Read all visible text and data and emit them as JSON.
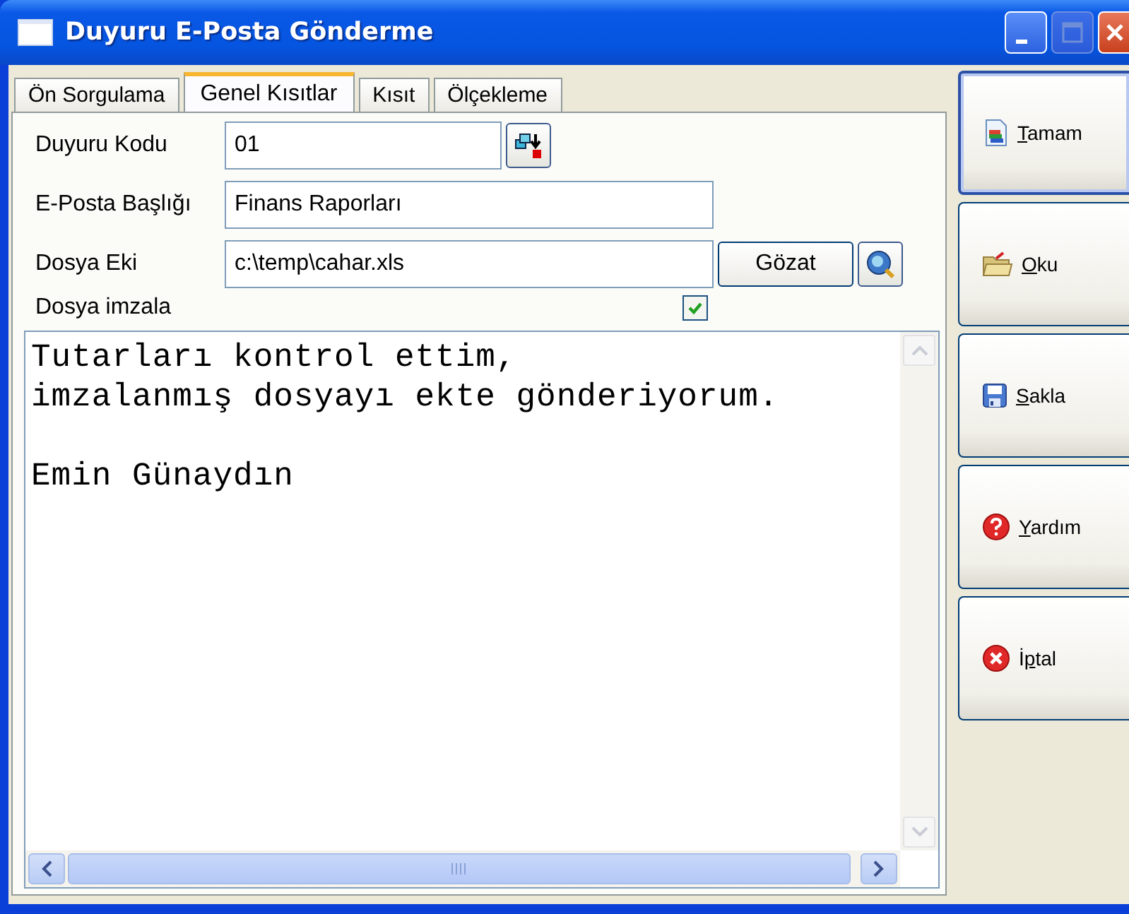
{
  "window": {
    "title": "Duyuru E-Posta Gönderme"
  },
  "tabs": [
    {
      "label": "Ön Sorgulama",
      "selected": false
    },
    {
      "label": "Genel Kısıtlar",
      "selected": true
    },
    {
      "label": "Kısıt",
      "selected": false
    },
    {
      "label": "Ölçekleme",
      "selected": false
    }
  ],
  "fields": [
    {
      "kind": "code",
      "label": "Duyuru Kodu",
      "value": "01"
    },
    {
      "kind": "text",
      "label": "E-Posta Başlığı",
      "value": "Finans Raporları"
    },
    {
      "kind": "file",
      "label": "Dosya Eki",
      "value": "c:\\temp\\cahar.xls",
      "button": "Gözat"
    },
    {
      "kind": "check",
      "label": "Dosya imzala",
      "checked": true
    }
  ],
  "memo": {
    "text": "Tutarları kontrol ettim,\nimzalanmış dosyayı ekte gönderiyorum.\n\nEmin Günaydın"
  },
  "buttons": [
    {
      "kind": "ok",
      "accel": "T",
      "rest": "amam",
      "focused": true
    },
    {
      "kind": "open",
      "accel": "O",
      "rest": "ku",
      "focused": false
    },
    {
      "kind": "save",
      "accel": "S",
      "rest": "akla",
      "focused": false
    },
    {
      "kind": "help",
      "accel": "Y",
      "rest": "ardım",
      "focused": false
    },
    {
      "kind": "cancel",
      "pre": "İ",
      "accel": "p",
      "rest": "tal",
      "focused": false
    }
  ]
}
